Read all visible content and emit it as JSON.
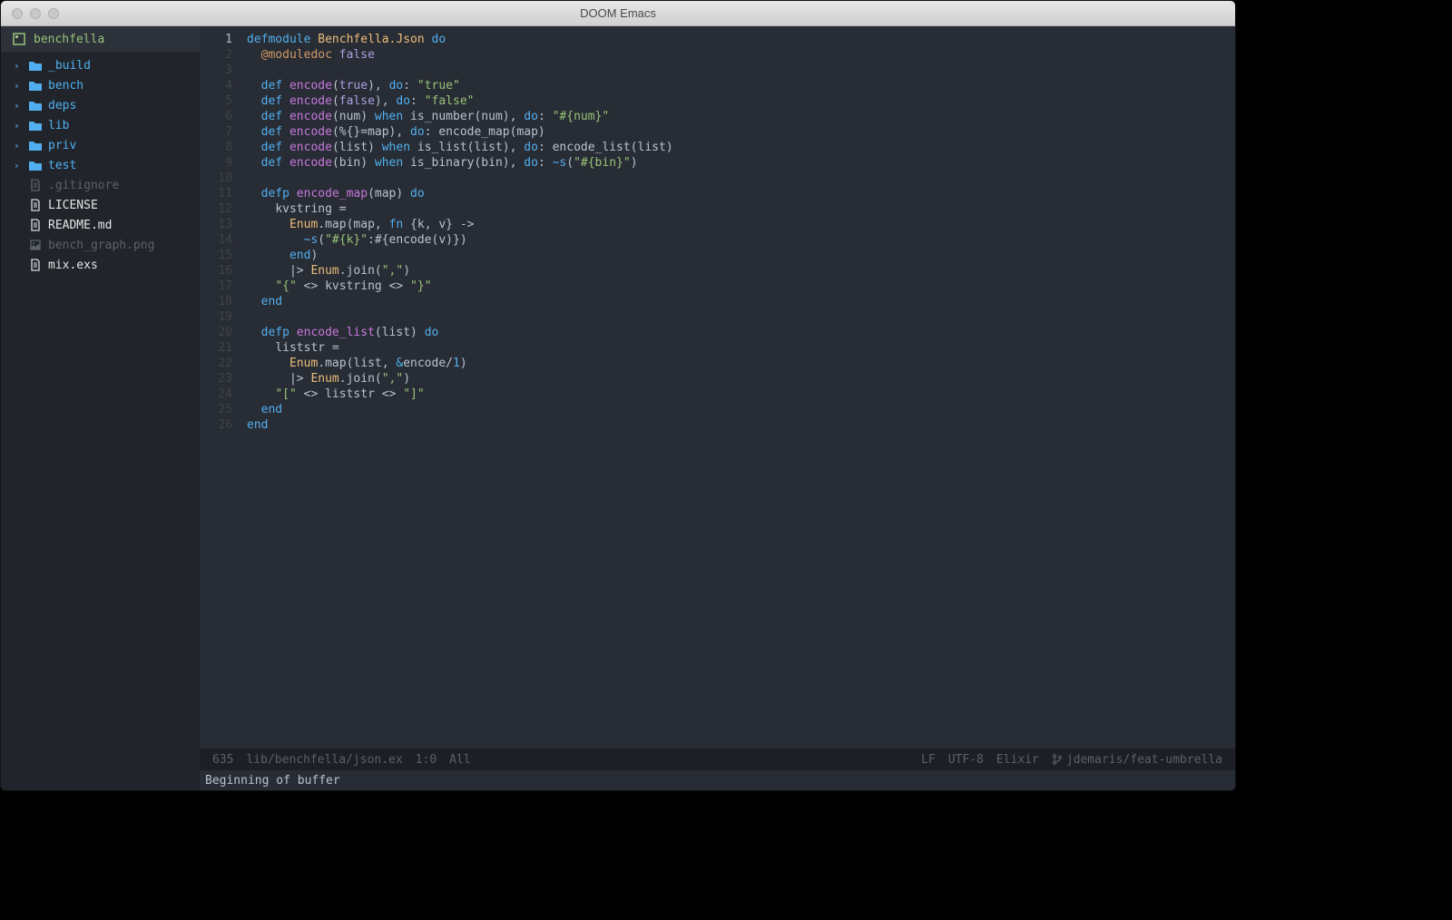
{
  "window": {
    "title": "DOOM Emacs"
  },
  "sidebar": {
    "root": "benchfella",
    "items": [
      {
        "type": "folder",
        "label": "_build"
      },
      {
        "type": "folder",
        "label": "bench"
      },
      {
        "type": "folder",
        "label": "deps"
      },
      {
        "type": "folder",
        "label": "lib"
      },
      {
        "type": "folder",
        "label": "priv"
      },
      {
        "type": "folder",
        "label": "test"
      },
      {
        "type": "file",
        "label": ".gitignore",
        "dim": true,
        "icon": "file"
      },
      {
        "type": "file",
        "label": "LICENSE",
        "icon": "file"
      },
      {
        "type": "file",
        "label": "README.md",
        "icon": "file"
      },
      {
        "type": "file",
        "label": "bench_graph.png",
        "dim": true,
        "icon": "image"
      },
      {
        "type": "file",
        "label": "mix.exs",
        "icon": "file",
        "active": true
      }
    ]
  },
  "code": {
    "current_line": 1,
    "lines": [
      [
        [
          "kw",
          "defmodule"
        ],
        [
          "sp",
          " "
        ],
        [
          "mod",
          "Benchfella.Json"
        ],
        [
          "sp",
          " "
        ],
        [
          "kw",
          "do"
        ]
      ],
      [
        [
          "sp",
          "  "
        ],
        [
          "sym",
          "@moduledoc"
        ],
        [
          "sp",
          " "
        ],
        [
          "atom",
          "false"
        ]
      ],
      [],
      [
        [
          "sp",
          "  "
        ],
        [
          "kw",
          "def"
        ],
        [
          "sp",
          " "
        ],
        [
          "fn",
          "encode"
        ],
        [
          "op",
          "("
        ],
        [
          "atom",
          "true"
        ],
        [
          "op",
          "), "
        ],
        [
          "special",
          "do"
        ],
        [
          "op",
          ": "
        ],
        [
          "str",
          "\"true\""
        ]
      ],
      [
        [
          "sp",
          "  "
        ],
        [
          "kw",
          "def"
        ],
        [
          "sp",
          " "
        ],
        [
          "fn",
          "encode"
        ],
        [
          "op",
          "("
        ],
        [
          "atom",
          "false"
        ],
        [
          "op",
          "), "
        ],
        [
          "special",
          "do"
        ],
        [
          "op",
          ": "
        ],
        [
          "str",
          "\"false\""
        ]
      ],
      [
        [
          "sp",
          "  "
        ],
        [
          "kw",
          "def"
        ],
        [
          "sp",
          " "
        ],
        [
          "fn",
          "encode"
        ],
        [
          "op",
          "(num) "
        ],
        [
          "kw",
          "when"
        ],
        [
          "op",
          " is_number(num), "
        ],
        [
          "special",
          "do"
        ],
        [
          "op",
          ": "
        ],
        [
          "str",
          "\"#{num}\""
        ]
      ],
      [
        [
          "sp",
          "  "
        ],
        [
          "kw",
          "def"
        ],
        [
          "sp",
          " "
        ],
        [
          "fn",
          "encode"
        ],
        [
          "op",
          "(%{}=map), "
        ],
        [
          "special",
          "do"
        ],
        [
          "op",
          ": encode_map(map)"
        ]
      ],
      [
        [
          "sp",
          "  "
        ],
        [
          "kw",
          "def"
        ],
        [
          "sp",
          " "
        ],
        [
          "fn",
          "encode"
        ],
        [
          "op",
          "(list) "
        ],
        [
          "kw",
          "when"
        ],
        [
          "op",
          " is_list(list), "
        ],
        [
          "special",
          "do"
        ],
        [
          "op",
          ": encode_list(list)"
        ]
      ],
      [
        [
          "sp",
          "  "
        ],
        [
          "kw",
          "def"
        ],
        [
          "sp",
          " "
        ],
        [
          "fn",
          "encode"
        ],
        [
          "op",
          "(bin) "
        ],
        [
          "kw",
          "when"
        ],
        [
          "op",
          " is_binary(bin), "
        ],
        [
          "special",
          "do"
        ],
        [
          "op",
          ": "
        ],
        [
          "special",
          "~s"
        ],
        [
          "op",
          "("
        ],
        [
          "str",
          "\"#{bin}\""
        ],
        [
          "op",
          ")"
        ]
      ],
      [],
      [
        [
          "sp",
          "  "
        ],
        [
          "kw",
          "defp"
        ],
        [
          "sp",
          " "
        ],
        [
          "fn",
          "encode_map"
        ],
        [
          "op",
          "(map) "
        ],
        [
          "kw",
          "do"
        ]
      ],
      [
        [
          "sp",
          "    "
        ],
        [
          "op",
          "kvstring ="
        ]
      ],
      [
        [
          "sp",
          "      "
        ],
        [
          "mod",
          "Enum"
        ],
        [
          "op",
          ".map(map, "
        ],
        [
          "kw",
          "fn"
        ],
        [
          "op",
          " {k, v} ->"
        ]
      ],
      [
        [
          "sp",
          "        "
        ],
        [
          "special",
          "~s"
        ],
        [
          "op",
          "("
        ],
        [
          "str",
          "\"#{k}\""
        ],
        [
          "op",
          ":#{encode(v)})"
        ]
      ],
      [
        [
          "sp",
          "      "
        ],
        [
          "kw",
          "end"
        ],
        [
          "op",
          ")"
        ]
      ],
      [
        [
          "sp",
          "      "
        ],
        [
          "op",
          "|> "
        ],
        [
          "mod",
          "Enum"
        ],
        [
          "op",
          ".join("
        ],
        [
          "str",
          "\",\""
        ],
        [
          "op",
          ")"
        ]
      ],
      [
        [
          "sp",
          "    "
        ],
        [
          "str",
          "\"{\""
        ],
        [
          "op",
          " <> kvstring <> "
        ],
        [
          "str",
          "\"}\""
        ]
      ],
      [
        [
          "sp",
          "  "
        ],
        [
          "kw",
          "end"
        ]
      ],
      [],
      [
        [
          "sp",
          "  "
        ],
        [
          "kw",
          "defp"
        ],
        [
          "sp",
          " "
        ],
        [
          "fn",
          "encode_list"
        ],
        [
          "op",
          "(list) "
        ],
        [
          "kw",
          "do"
        ]
      ],
      [
        [
          "sp",
          "    "
        ],
        [
          "op",
          "liststr ="
        ]
      ],
      [
        [
          "sp",
          "      "
        ],
        [
          "mod",
          "Enum"
        ],
        [
          "op",
          ".map(list, "
        ],
        [
          "special",
          "&"
        ],
        [
          "op",
          "encode/"
        ],
        [
          "special",
          "1"
        ],
        [
          "op",
          ")"
        ]
      ],
      [
        [
          "sp",
          "      "
        ],
        [
          "op",
          "|> "
        ],
        [
          "mod",
          "Enum"
        ],
        [
          "op",
          ".join("
        ],
        [
          "str",
          "\",\""
        ],
        [
          "op",
          ")"
        ]
      ],
      [
        [
          "sp",
          "    "
        ],
        [
          "str",
          "\"[\""
        ],
        [
          "op",
          " <> liststr <> "
        ],
        [
          "str",
          "\"]\""
        ]
      ],
      [
        [
          "sp",
          "  "
        ],
        [
          "kw",
          "end"
        ]
      ],
      [
        [
          "kw",
          "end"
        ]
      ]
    ]
  },
  "modeline": {
    "size": "635",
    "path": "lib/benchfella/json.ex",
    "pos": "1:0",
    "scroll": "All",
    "eol": "LF",
    "enc": "UTF-8",
    "mode": "Elixir",
    "branch": "jdemaris/feat-umbrella"
  },
  "echo": "Beginning of buffer"
}
